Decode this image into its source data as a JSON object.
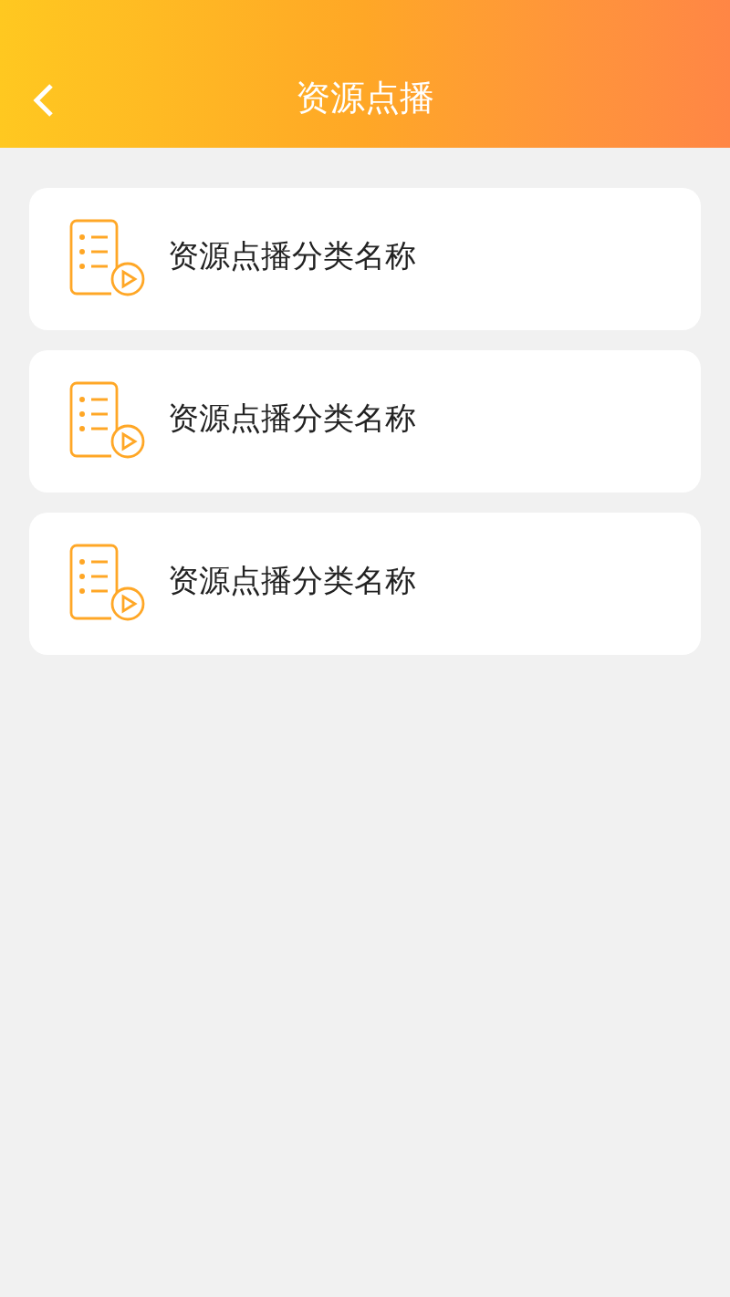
{
  "header": {
    "title": "资源点播"
  },
  "categories": [
    {
      "name": "资源点播分类名称"
    },
    {
      "name": "资源点播分类名称"
    },
    {
      "name": "资源点播分类名称"
    }
  ]
}
